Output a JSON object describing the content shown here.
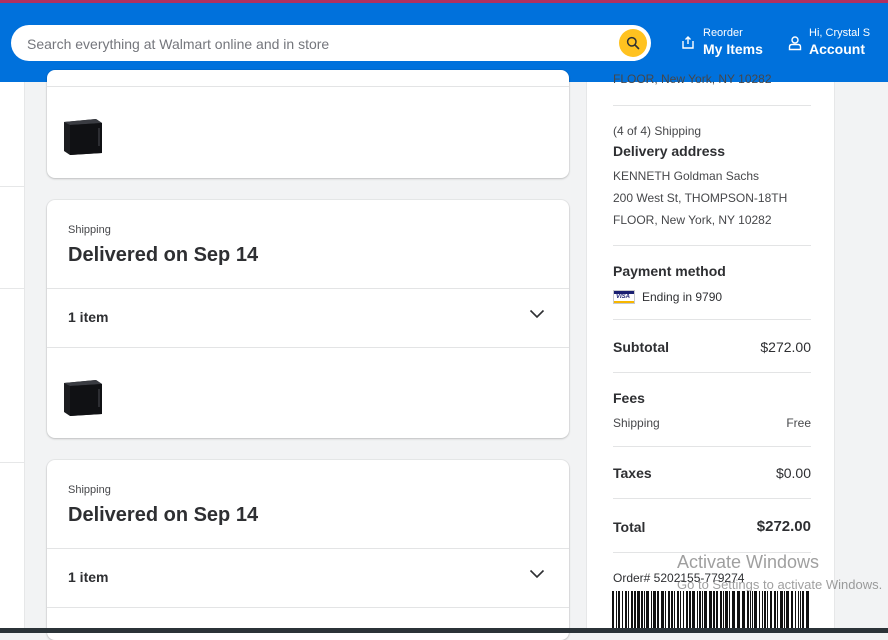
{
  "header": {
    "search_placeholder": "Search everything at Walmart online and in store",
    "reorder": {
      "small": "Reorder",
      "big": "My Items"
    },
    "account": {
      "small": "Hi, Crystal S",
      "big": "Account"
    }
  },
  "shipments": [
    {
      "label": "Shipping",
      "title": "Delivered on Sep 14",
      "items": "1 item"
    },
    {
      "label": "Shipping",
      "title": "Delivered on Sep 14",
      "items": "1 item"
    }
  ],
  "side": {
    "prev_address_tail": "FLOOR, New York, NY 10282",
    "shipping_count": "(4 of 4) Shipping",
    "delivery_heading": "Delivery address",
    "address": [
      "KENNETH Goldman Sachs",
      "200 West St, THOMPSON-18TH",
      "FLOOR, New York, NY 10282"
    ],
    "payment_heading": "Payment method",
    "card_brand": "VISA",
    "payment_ending": "Ending in 9790",
    "subtotal_label": "Subtotal",
    "subtotal_value": "$272.00",
    "fees_heading": "Fees",
    "shipping_label": "Shipping",
    "shipping_value": "Free",
    "taxes_label": "Taxes",
    "taxes_value": "$0.00",
    "total_label": "Total",
    "total_value": "$272.00",
    "order_number": "Order# 5202155-779274"
  },
  "watermark": {
    "line1": "Activate Windows",
    "line2": "Go to Settings to activate Windows."
  },
  "colors": {
    "header_blue": "#0071dc",
    "spark_yellow": "#ffc220"
  }
}
